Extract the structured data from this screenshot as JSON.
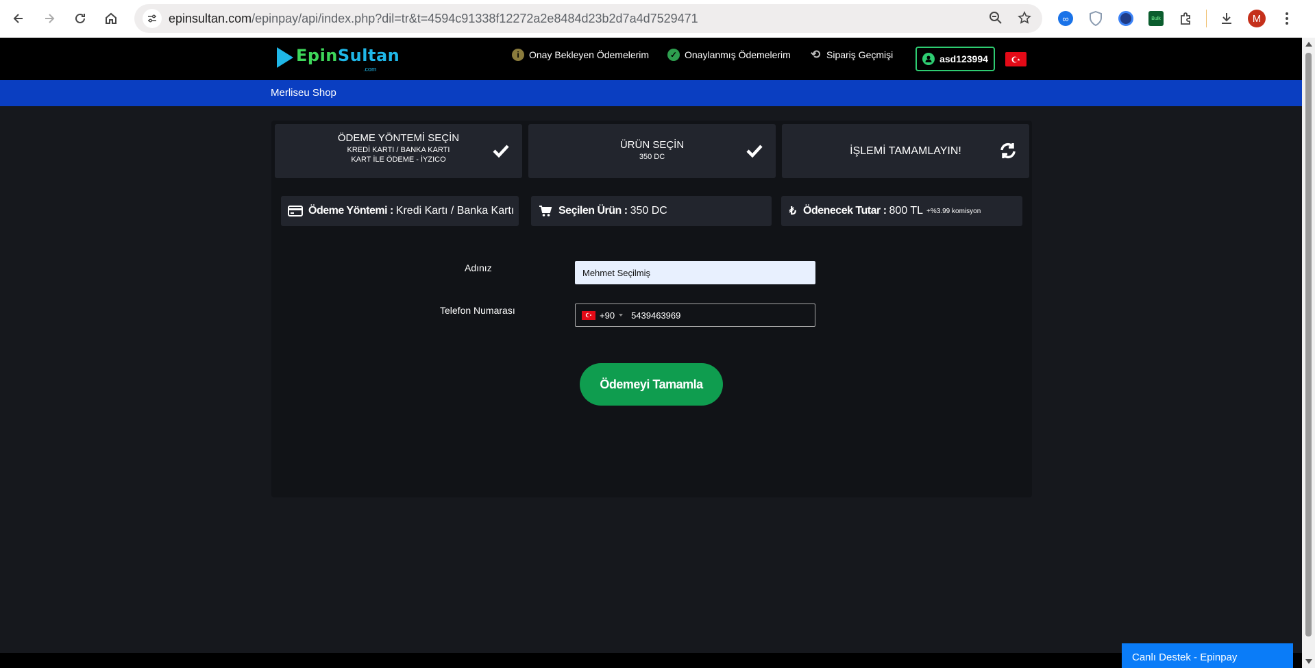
{
  "browser": {
    "url_host": "epinsultan.com",
    "url_path": "/epinpay/api/index.php?dil=tr&t=4594c91338f12272a2e8484d23b2d7a4d7529471",
    "profile_initial": "M"
  },
  "header": {
    "logo_text_green": "Epin",
    "logo_text_blue": "Sultan",
    "logo_suffix": ".com",
    "nav": [
      {
        "label": "Onay Bekleyen Ödemelerim",
        "icon": "info-icon"
      },
      {
        "label": "Onaylanmış Ödemelerim",
        "icon": "check-circle-icon"
      },
      {
        "label": "Sipariş Geçmişi",
        "icon": "history-icon"
      }
    ],
    "username": "asd123994",
    "language": "TR"
  },
  "shop_bar": {
    "title": "Merliseu Shop"
  },
  "steps": [
    {
      "title": "ÖDEME YÖNTEMİ SEÇİN",
      "line1": "KREDİ KARTI / BANKA KARTI",
      "line2": "KART İLE ÖDEME - İYZICO",
      "status": "done"
    },
    {
      "title": "ÜRÜN SEÇİN",
      "line1": "350 DC",
      "line2": "",
      "status": "done"
    },
    {
      "title": "İŞLEMİ TAMAMLAYIN!",
      "line1": "",
      "line2": "",
      "status": "active"
    }
  ],
  "summary": {
    "method_label": "Ödeme Yöntemi :",
    "method_value": "Kredi Kartı / Banka Kartı",
    "product_label": "Seçilen Ürün :",
    "product_value": "350 DC",
    "amount_label": "Ödenecek Tutar :",
    "amount_value": "800 TL",
    "commission": "+%3.99 komisyon"
  },
  "form": {
    "name_label": "Adınız",
    "name_value": "Mehmet Seçilmiş",
    "phone_label": "Telefon Numarası",
    "phone_code": "+90",
    "phone_value": "5439463969",
    "submit_label": "Ödemeyi Tamamla"
  },
  "support": {
    "label": "Canlı Destek - Epinpay"
  },
  "colors": {
    "accent_green": "#0f9d4f",
    "shop_bar_blue": "#0a3ec1",
    "support_blue": "#0a7cf8"
  }
}
